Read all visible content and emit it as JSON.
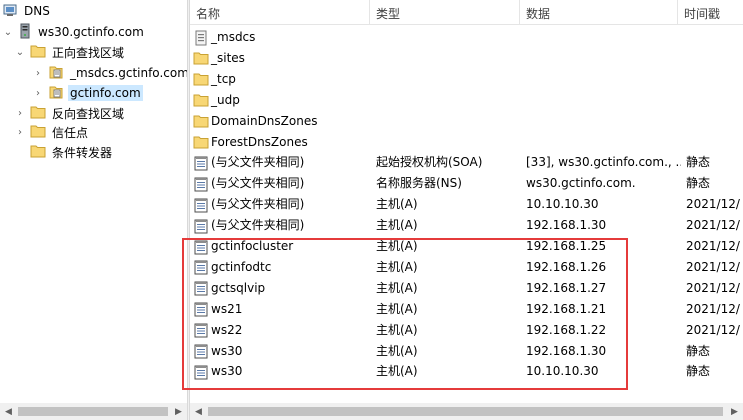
{
  "tree": {
    "root": "DNS",
    "server": "ws30.gctinfo.com",
    "forward_zones": "正向查找区域",
    "zone_msdcs": "_msdcs.gctinfo.com",
    "zone_gctinfo": "gctinfo.com",
    "reverse_zones": "反向查找区域",
    "trust_points": "信任点",
    "conditional_forwarders": "条件转发器"
  },
  "columns": {
    "name": "名称",
    "type": "类型",
    "data": "数据",
    "timestamp": "时间戳"
  },
  "records": [
    {
      "name": "_msdcs",
      "type": "",
      "data": "",
      "time": "",
      "icon": "zone-file-icon"
    },
    {
      "name": "_sites",
      "type": "",
      "data": "",
      "time": "",
      "icon": "folder-icon"
    },
    {
      "name": "_tcp",
      "type": "",
      "data": "",
      "time": "",
      "icon": "folder-icon"
    },
    {
      "name": "_udp",
      "type": "",
      "data": "",
      "time": "",
      "icon": "folder-icon"
    },
    {
      "name": "DomainDnsZones",
      "type": "",
      "data": "",
      "time": "",
      "icon": "folder-icon"
    },
    {
      "name": "ForestDnsZones",
      "type": "",
      "data": "",
      "time": "",
      "icon": "folder-icon"
    },
    {
      "name": "(与父文件夹相同)",
      "type": "起始授权机构(SOA)",
      "data": "[33], ws30.gctinfo.com., ...",
      "time": "静态",
      "icon": "record-icon"
    },
    {
      "name": "(与父文件夹相同)",
      "type": "名称服务器(NS)",
      "data": "ws30.gctinfo.com.",
      "time": "静态",
      "icon": "record-icon"
    },
    {
      "name": "(与父文件夹相同)",
      "type": "主机(A)",
      "data": "10.10.10.30",
      "time": "2021/12/",
      "icon": "record-icon"
    },
    {
      "name": "(与父文件夹相同)",
      "type": "主机(A)",
      "data": "192.168.1.30",
      "time": "2021/12/",
      "icon": "record-icon"
    },
    {
      "name": "gctinfocluster",
      "type": "主机(A)",
      "data": "192.168.1.25",
      "time": "2021/12/",
      "icon": "record-icon"
    },
    {
      "name": "gctinfodtc",
      "type": "主机(A)",
      "data": "192.168.1.26",
      "time": "2021/12/",
      "icon": "record-icon"
    },
    {
      "name": "gctsqlvip",
      "type": "主机(A)",
      "data": "192.168.1.27",
      "time": "2021/12/",
      "icon": "record-icon"
    },
    {
      "name": "ws21",
      "type": "主机(A)",
      "data": "192.168.1.21",
      "time": "2021/12/",
      "icon": "record-icon"
    },
    {
      "name": "ws22",
      "type": "主机(A)",
      "data": "192.168.1.22",
      "time": "2021/12/",
      "icon": "record-icon"
    },
    {
      "name": "ws30",
      "type": "主机(A)",
      "data": "192.168.1.30",
      "time": "静态",
      "icon": "record-icon"
    },
    {
      "name": "ws30",
      "type": "主机(A)",
      "data": "10.10.10.30",
      "time": "静态",
      "icon": "record-icon"
    }
  ],
  "colors": {
    "selection": "#cce8ff",
    "highlight_border": "#e53b3b",
    "folder": "#f8d775"
  }
}
